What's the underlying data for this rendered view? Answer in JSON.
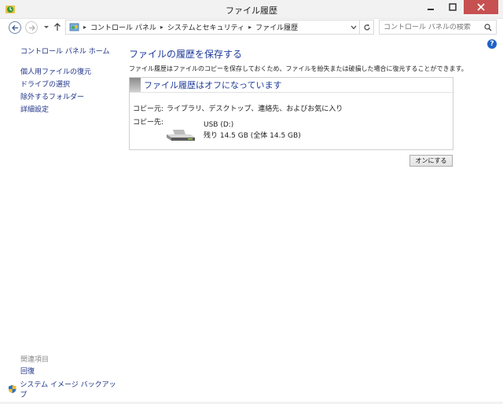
{
  "window": {
    "title": "ファイル履歴"
  },
  "address_bar": {
    "breadcrumbs": [
      "コントロール パネル",
      "システムとセキュリティ",
      "ファイル履歴"
    ],
    "search_placeholder": "コントロール パネルの検索"
  },
  "left_nav": {
    "home": "コントロール パネル ホーム",
    "links": [
      "個人用ファイルの復元",
      "ドライブの選択",
      "除外するフォルダー",
      "詳細設定"
    ],
    "related_heading": "関連項目",
    "related": [
      "回復",
      "システム イメージ バックアップ"
    ]
  },
  "main": {
    "heading": "ファイルの履歴を保存する",
    "description": "ファイル履歴はファイルのコピーを保存しておくため、ファイルを紛失または破損した場合に復元することができます。",
    "status_title": "ファイル履歴はオフになっています",
    "source_label": "コピー元:",
    "source_value": "ライブラリ、デスクトップ、連絡先、およびお気に入り",
    "dest_label": "コピー先:",
    "drive_name": "USB (D:)",
    "drive_space": "残り 14.5 GB (全体 14.5 GB)",
    "turn_on_button": "オンにする"
  },
  "colors": {
    "link": "#1e3287",
    "heading": "#1e3a9a",
    "close_button": "#c75050"
  },
  "icons": [
    "file-history-app-icon",
    "minimize-icon",
    "maximize-icon",
    "close-icon",
    "back-icon",
    "forward-icon",
    "recent-locations-icon",
    "up-icon",
    "control-panel-icon",
    "chevron-right-icon",
    "dropdown-icon",
    "refresh-icon",
    "search-icon",
    "help-icon",
    "usb-drive-icon",
    "shield-icon"
  ]
}
